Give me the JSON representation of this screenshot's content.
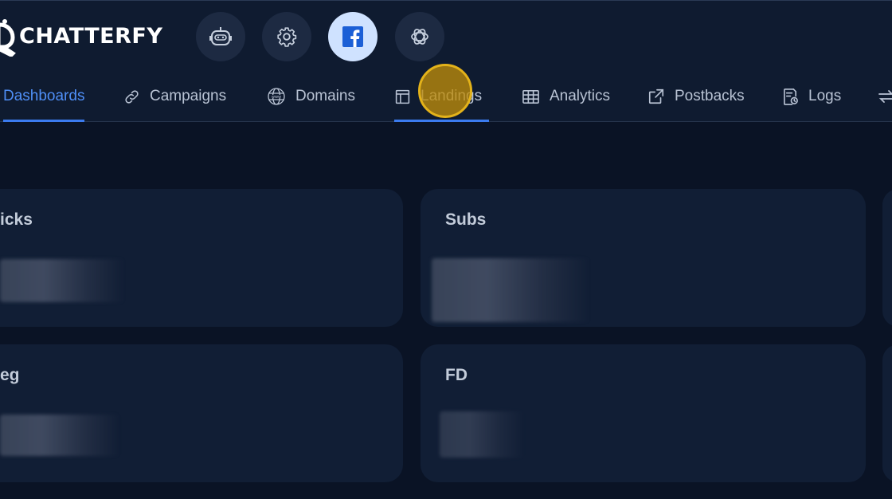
{
  "app": {
    "name": "CHATTERFY"
  },
  "top_icons": [
    {
      "name": "bot-icon",
      "active": false
    },
    {
      "name": "gear-icon",
      "active": false
    },
    {
      "name": "facebook-icon",
      "active": true
    },
    {
      "name": "openai-icon",
      "active": false
    }
  ],
  "nav": {
    "tabs": [
      {
        "label": "Dashboards",
        "icon": "",
        "active": true
      },
      {
        "label": "Campaigns",
        "icon": "link-icon",
        "active": false
      },
      {
        "label": "Domains",
        "icon": "globe-www-icon",
        "active": false
      },
      {
        "label": "Landings",
        "icon": "layout-icon",
        "active": false,
        "underlined": true
      },
      {
        "label": "Analytics",
        "icon": "table-icon",
        "active": false
      },
      {
        "label": "Postbacks",
        "icon": "external-link-icon",
        "active": false
      },
      {
        "label": "Logs",
        "icon": "log-file-icon",
        "active": false
      }
    ]
  },
  "cards": [
    {
      "title": "icks",
      "value_hidden": true
    },
    {
      "title": "Subs",
      "value_hidden": true
    },
    {
      "title": "eg",
      "value_hidden": true
    },
    {
      "title": "FD",
      "value_hidden": true
    }
  ],
  "colors": {
    "accent": "#3b7bef",
    "background": "#0b1426",
    "card": "#111e35",
    "cursor_highlight": "#e3b21a"
  }
}
